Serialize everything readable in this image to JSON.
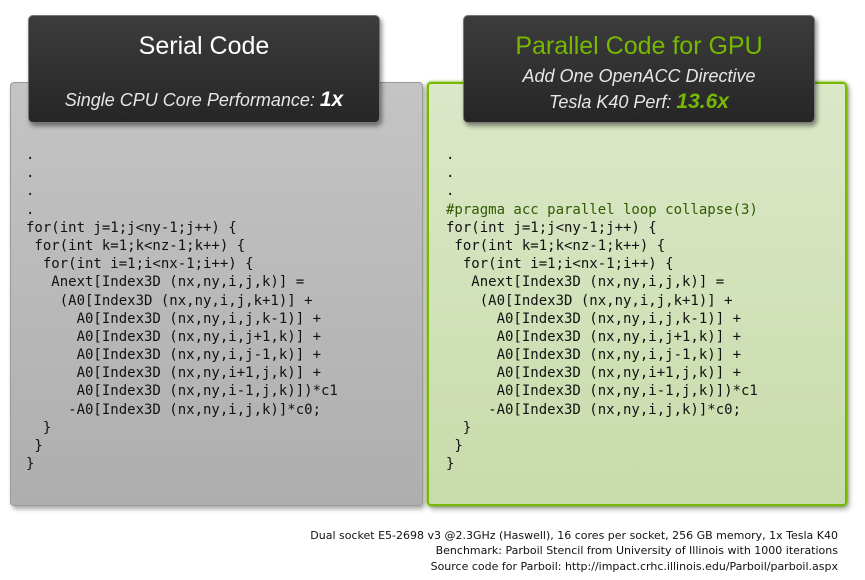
{
  "serial": {
    "title": "Serial Code",
    "perf_label": "Single CPU Core Performance: ",
    "speedup": "1x",
    "code_lines": [
      ".",
      ".",
      ".",
      ".",
      "for(int j=1;j<ny-1;j++) {",
      " for(int k=1;k<nz-1;k++) {",
      "  for(int i=1;i<nx-1;i++) {",
      "   Anext[Index3D (nx,ny,i,j,k)] =",
      "    (A0[Index3D (nx,ny,i,j,k+1)] +",
      "      A0[Index3D (nx,ny,i,j,k-1)] +",
      "      A0[Index3D (nx,ny,i,j+1,k)] +",
      "      A0[Index3D (nx,ny,i,j-1,k)] +",
      "      A0[Index3D (nx,ny,i+1,j,k)] +",
      "      A0[Index3D (nx,ny,i-1,j,k)])*c1",
      "     -A0[Index3D (nx,ny,i,j,k)]*c0;",
      "  }",
      " }",
      "}"
    ]
  },
  "parallel": {
    "title": "Parallel Code for GPU",
    "subtitle": "Add One OpenACC Directive",
    "perf_label": "Tesla K40 Perf: ",
    "speedup": "13.6x",
    "code_lines": [
      ".",
      ".",
      ".",
      "#pragma acc parallel loop collapse(3)",
      "for(int j=1;j<ny-1;j++) {",
      " for(int k=1;k<nz-1;k++) {",
      "  for(int i=1;i<nx-1;i++) {",
      "   Anext[Index3D (nx,ny,i,j,k)] =",
      "    (A0[Index3D (nx,ny,i,j,k+1)] +",
      "      A0[Index3D (nx,ny,i,j,k-1)] +",
      "      A0[Index3D (nx,ny,i,j+1,k)] +",
      "      A0[Index3D (nx,ny,i,j-1,k)] +",
      "      A0[Index3D (nx,ny,i+1,j,k)] +",
      "      A0[Index3D (nx,ny,i-1,j,k)])*c1",
      "     -A0[Index3D (nx,ny,i,j,k)]*c0;",
      "  }",
      " }",
      "}"
    ]
  },
  "footnotes": [
    "Dual socket E5-2698 v3 @2.3GHz (Haswell), 16 cores per socket, 256 GB memory, 1x Tesla K40",
    "Benchmark: Parboil Stencil from University of Illinois with 1000 iterations",
    "Source code for Parboil: http://impact.crhc.illinois.edu/Parboil/parboil.aspx"
  ],
  "colors": {
    "accent": "#76b900",
    "header_bg": "#2e2e2e",
    "serial_panel": "#b8b8b8",
    "parallel_panel": "#d3e3bb"
  }
}
